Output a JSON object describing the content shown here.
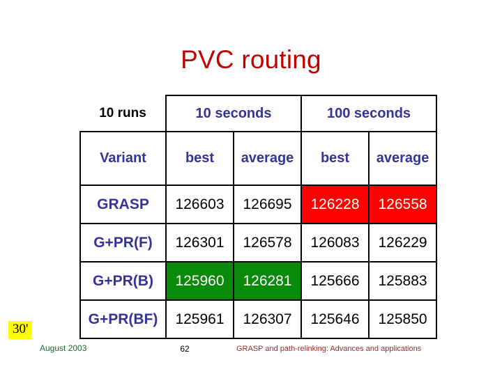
{
  "slide": {
    "title": "PVC routing",
    "title_color": "#c00000"
  },
  "table": {
    "corner_label": "10 runs",
    "group_headers": [
      {
        "label": "10 seconds",
        "span": 2
      },
      {
        "label": "100 seconds",
        "span": 2
      }
    ],
    "column_headers": [
      "Variant",
      "best",
      "average",
      "best",
      "average"
    ],
    "header_color": "#333399",
    "rows": [
      {
        "variant": "GRASP",
        "cells": [
          {
            "value": "126603",
            "highlight": "none"
          },
          {
            "value": "126695",
            "highlight": "none"
          },
          {
            "value": "126228",
            "highlight": "red"
          },
          {
            "value": "126558",
            "highlight": "red"
          }
        ]
      },
      {
        "variant": "G+PR(F)",
        "cells": [
          {
            "value": "126301",
            "highlight": "none"
          },
          {
            "value": "126578",
            "highlight": "none"
          },
          {
            "value": "126083",
            "highlight": "none"
          },
          {
            "value": "126229",
            "highlight": "none"
          }
        ]
      },
      {
        "variant": "G+PR(B)",
        "cells": [
          {
            "value": "125960",
            "highlight": "green"
          },
          {
            "value": "126281",
            "highlight": "green"
          },
          {
            "value": "125666",
            "highlight": "none"
          },
          {
            "value": "125883",
            "highlight": "none"
          }
        ]
      },
      {
        "variant": "G+PR(BF)",
        "cells": [
          {
            "value": "125961",
            "highlight": "none"
          },
          {
            "value": "126307",
            "highlight": "none"
          },
          {
            "value": "125646",
            "highlight": "none"
          },
          {
            "value": "125850",
            "highlight": "none"
          }
        ]
      }
    ],
    "highlight_colors": {
      "red": "#ff0000",
      "green": "#0a8a0a"
    }
  },
  "annotation": {
    "badge_label": "30'",
    "badge_background": "#ffff00"
  },
  "footer": {
    "date": "August 2003",
    "page_number": "62",
    "reference": "GRASP and path-relinking: Advances and applications",
    "date_color": "#1a6b2a",
    "reference_color": "#9c2a2a"
  }
}
